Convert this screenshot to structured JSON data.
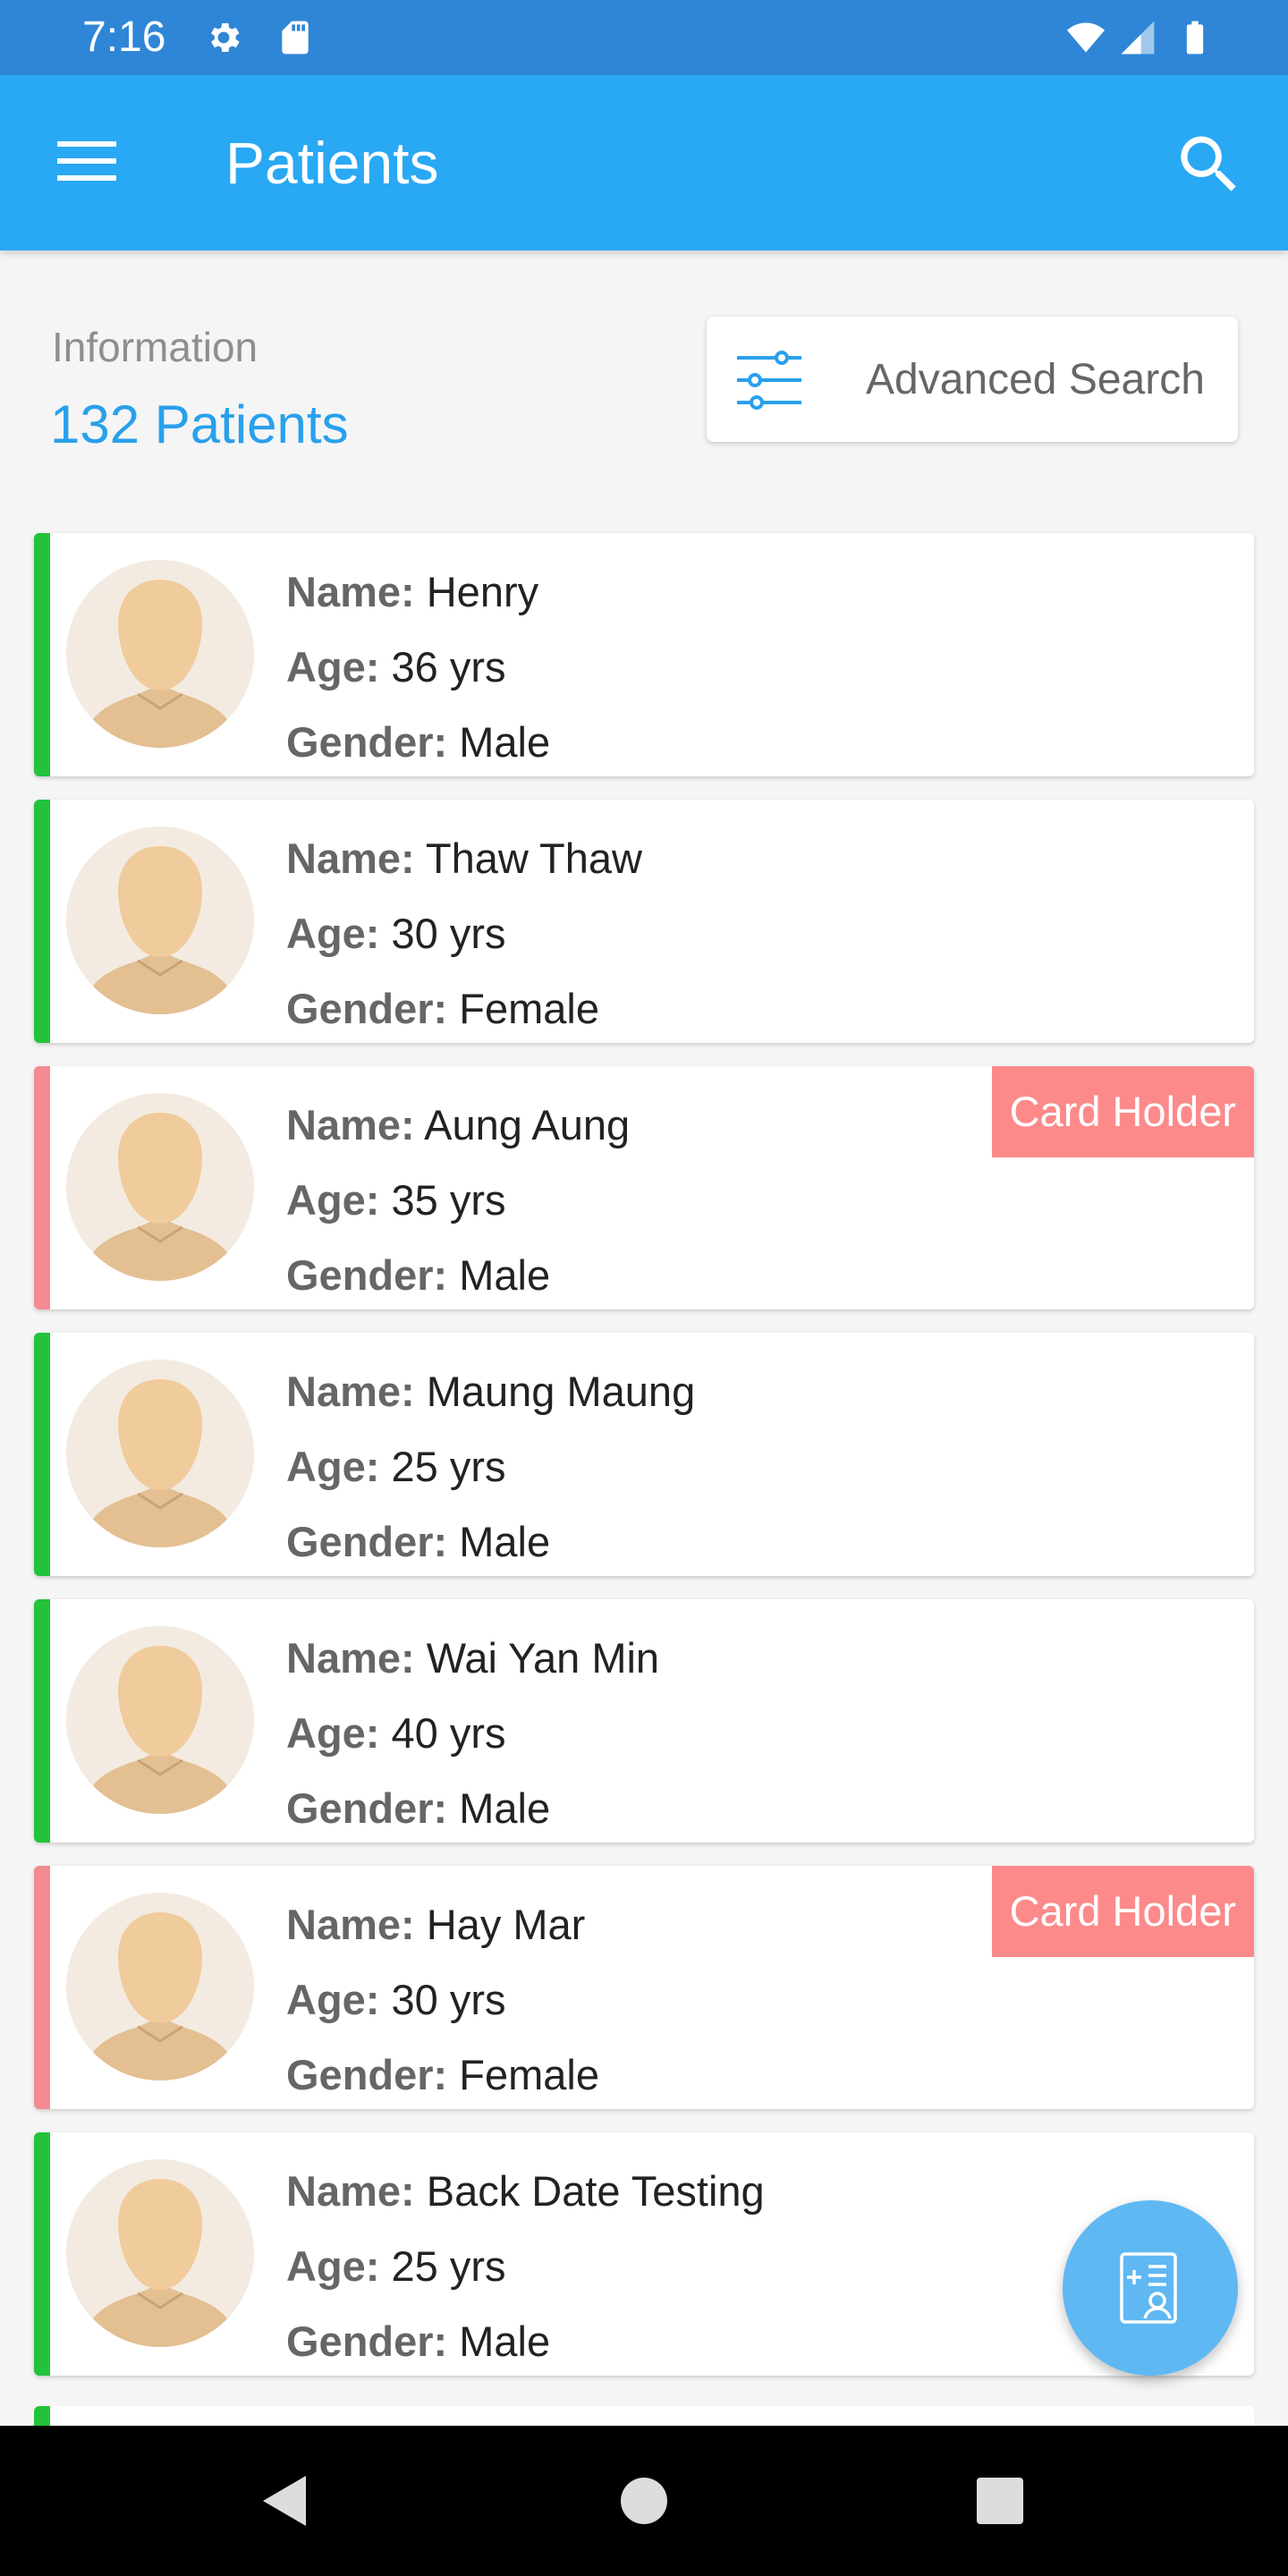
{
  "status_bar": {
    "time": "7:16"
  },
  "app_bar": {
    "title": "Patients"
  },
  "info": {
    "label": "Information",
    "count": "132 Patients"
  },
  "advanced_search": {
    "label": "Advanced Search"
  },
  "labels": {
    "name": "Name:",
    "age": "Age:",
    "gender": "Gender:"
  },
  "colors": {
    "primary": "#29a8f4",
    "status_bar": "#2f86d6",
    "green": "#22c33a",
    "pink": "#f48a92",
    "badge": "#fc8a8a",
    "accent_text": "#29a0ec"
  },
  "patients": [
    {
      "name": "Henry",
      "age": "36 yrs",
      "gender": "Male",
      "status": "green"
    },
    {
      "name": "Thaw Thaw",
      "age": "30 yrs",
      "gender": "Female",
      "status": "green"
    },
    {
      "name": "Aung Aung",
      "age": "35 yrs",
      "gender": "Male",
      "status": "pink",
      "badge": "Card Holder"
    },
    {
      "name": "Maung Maung",
      "age": "25 yrs",
      "gender": "Male",
      "status": "green"
    },
    {
      "name": "Wai Yan Min",
      "age": "40 yrs",
      "gender": "Male",
      "status": "green"
    },
    {
      "name": "Hay Mar",
      "age": "30 yrs",
      "gender": "Female",
      "status": "pink",
      "badge": "Card Holder"
    },
    {
      "name": "Back Date Testing",
      "age": "25 yrs",
      "gender": "Male",
      "status": "green"
    }
  ],
  "icons": {
    "menu": "hamburger-menu-icon",
    "search": "search-icon",
    "filter": "sliders-icon",
    "avatar": "person-avatar",
    "fab": "add-patient-record-icon"
  }
}
